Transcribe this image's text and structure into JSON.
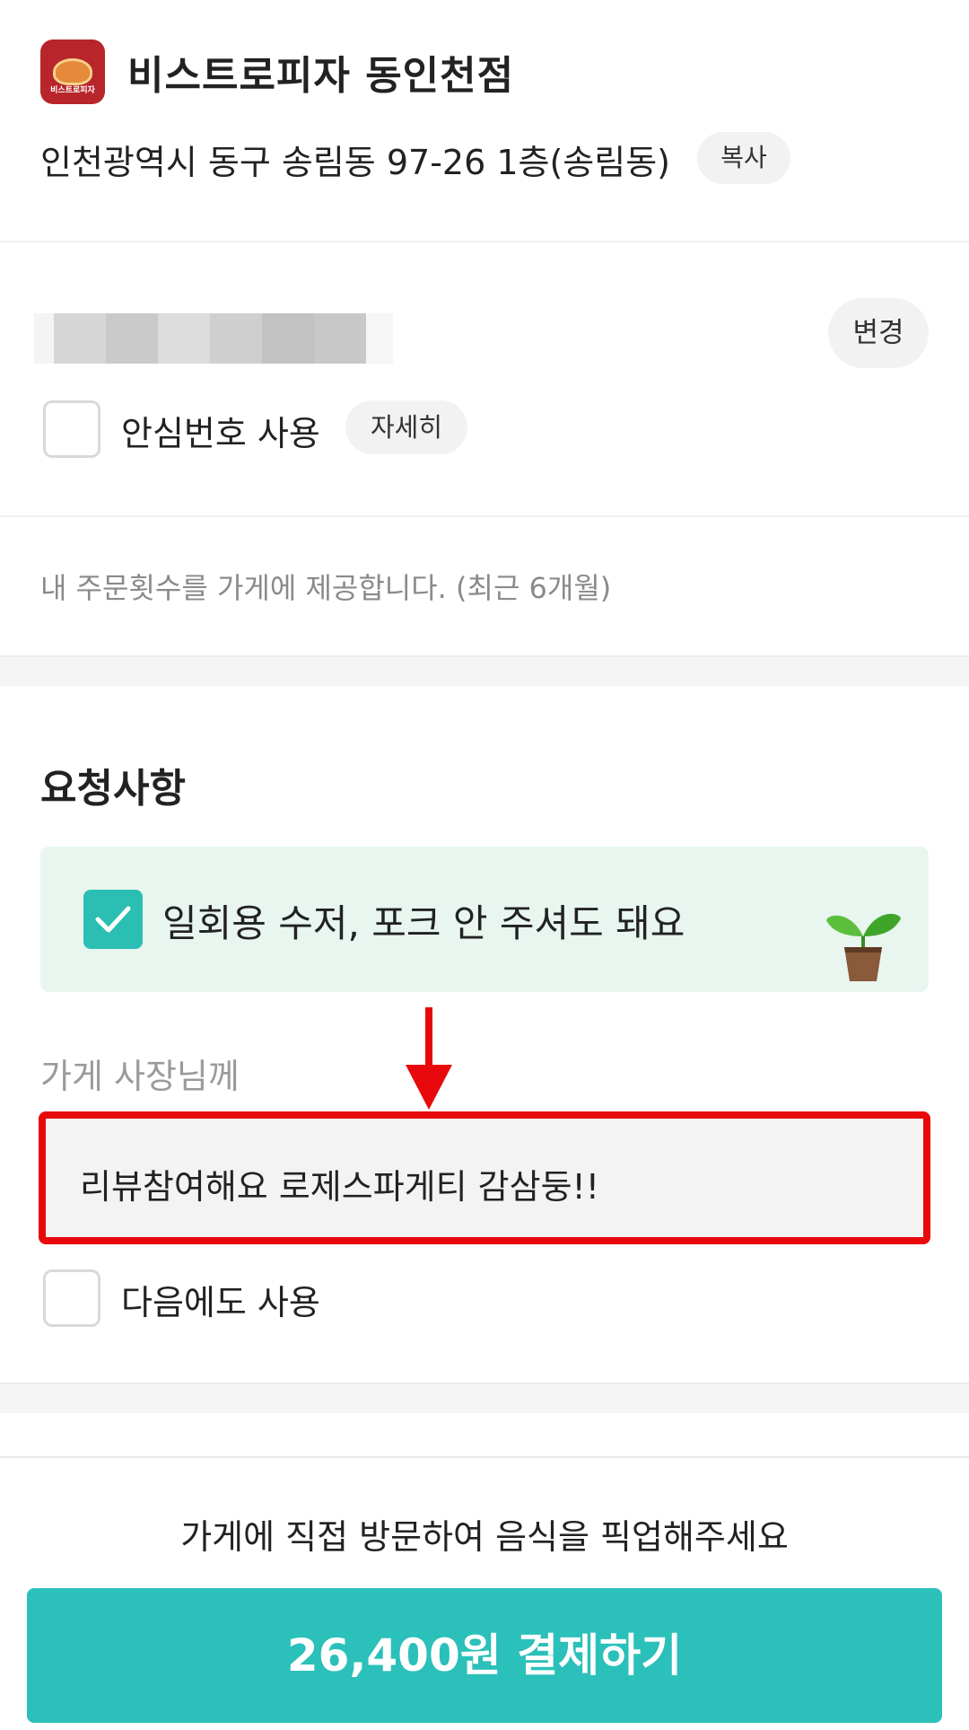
{
  "store": {
    "logo_text": "비스트로피자",
    "name": "비스트로피자 동인천점",
    "address": "인천광역시 동구 송림동 97-26 1층(송림동)",
    "copy_label": "복사"
  },
  "contact": {
    "change_label": "변경",
    "safe_number_label": "안심번호 사용",
    "detail_label": "자세히",
    "order_count_note": "내 주문횟수를 가게에 제공합니다. (최근 6개월)"
  },
  "requests": {
    "title": "요청사항",
    "eco_option_label": "일회용 수저, 포크 안 주셔도 돼요",
    "eco_checked": true,
    "owner_label": "가게 사장님께",
    "owner_message": "리뷰참여해요 로제스파게티 감삼둥!!",
    "reuse_label": "다음에도 사용"
  },
  "footer": {
    "pickup_note": "가게에 직접 방문하여 음식을 픽업해주세요",
    "pay_label": "26,400원 결제하기"
  },
  "colors": {
    "accent": "#2bc0ba",
    "eco_background": "#e8f6ef",
    "highlight": "#e8090c"
  }
}
